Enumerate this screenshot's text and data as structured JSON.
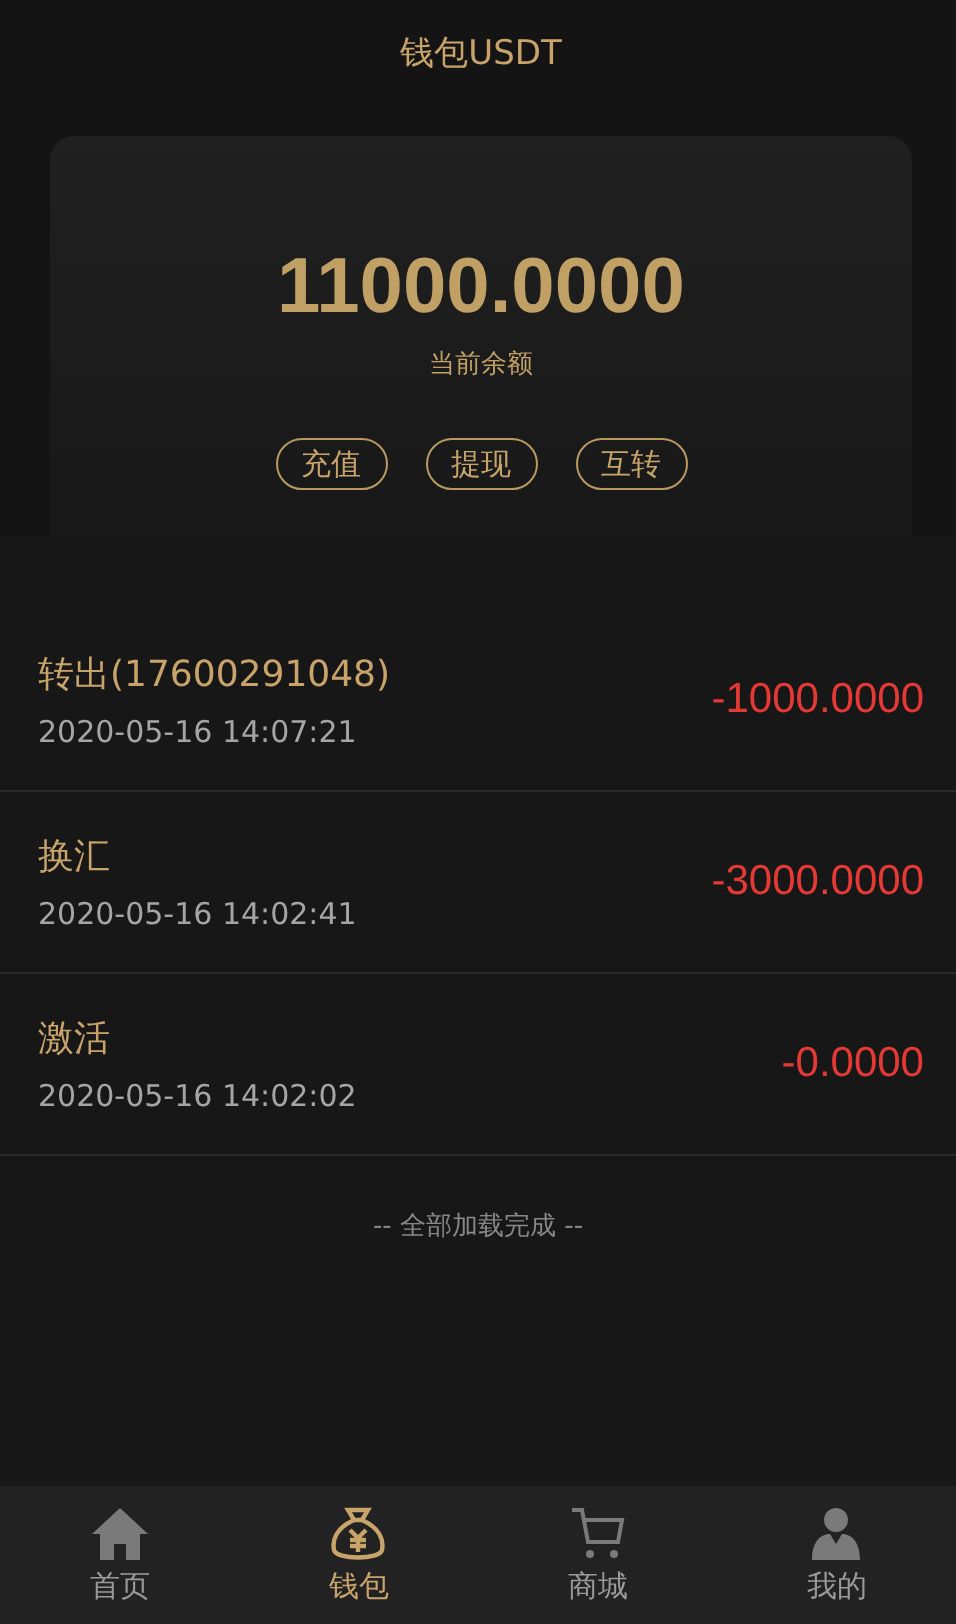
{
  "header": {
    "title": "钱包USDT"
  },
  "balance": {
    "amount": "11000.0000",
    "label": "当前余额",
    "actions": [
      "充值",
      "提现",
      "互转"
    ]
  },
  "transactions": [
    {
      "title": "转出(17600291048)",
      "time": "2020-05-16 14:07:21",
      "amount": "-1000.0000"
    },
    {
      "title": "换汇",
      "time": "2020-05-16 14:02:41",
      "amount": "-3000.0000"
    },
    {
      "title": "激活",
      "time": "2020-05-16 14:02:02",
      "amount": "-0.0000"
    }
  ],
  "list_end": "-- 全部加载完成 --",
  "nav": [
    {
      "kind": "home",
      "label": "首页",
      "selected": false
    },
    {
      "kind": "wallet",
      "label": "钱包",
      "selected": true
    },
    {
      "kind": "cart",
      "label": "商城",
      "selected": false
    },
    {
      "kind": "user",
      "label": "我的",
      "selected": false
    }
  ]
}
